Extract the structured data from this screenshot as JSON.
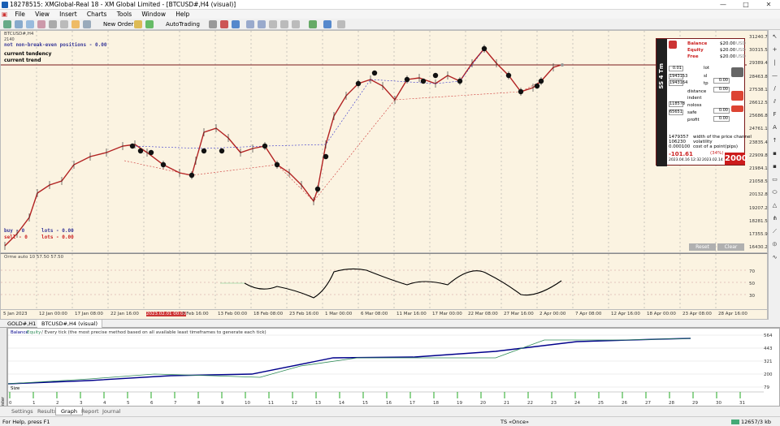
{
  "window": {
    "title": "18278515: XMGlobal-Real 18 - XM Global Limited - [BTCUSD#,H4 (visual)]",
    "min": "—",
    "max": "□",
    "close": "✕"
  },
  "menu": [
    "File",
    "View",
    "Insert",
    "Charts",
    "Tools",
    "Window",
    "Help"
  ],
  "toolbar": {
    "new_order": "New Order",
    "autotrading": "AutoTrading"
  },
  "chart": {
    "symbol_label": "BTCUSD#,H4",
    "sub_label": "2140",
    "info1": "not non-break-even positions - 0.00",
    "info2": "current tendency",
    "info3": "current trend",
    "buy": "buy - 0",
    "sell": "sell - 0",
    "lots_buy": "lots - 0.00",
    "lots_sell": "lots - 0.00",
    "price_axis": [
      "31240.75",
      "30315.50",
      "29389.45",
      "28463.80",
      "27538.15",
      "26612.50",
      "25686.80",
      "24761.15",
      "23835.45",
      "22909.80",
      "21984.15",
      "21058.50",
      "20132.85",
      "19207.20",
      "18281.55",
      "17355.90",
      "16430.25"
    ],
    "current_price": "29389.45",
    "reset_label": "Reset",
    "clear_label": "Clear"
  },
  "panel": {
    "side_label": "SS 4 Tm",
    "balance_label": "Balance",
    "balance_val": "$20.00",
    "equity_label": "Equity",
    "equity_val": "$20.00",
    "free_label": "Free",
    "free_val": "$20.00",
    "usd": "USD",
    "lot_label": "lot",
    "sl_label": "sl",
    "tp_label": "tp",
    "distance_label": "distance",
    "indent_label": "indent",
    "noloss_label": "noloss",
    "safe_label": "safe",
    "profit_label": "profit",
    "vals": [
      "0.00",
      "0.00",
      "0.00",
      "0.00"
    ],
    "small_vals": [
      "0.01",
      "1943153",
      "1943164",
      "118578",
      "65651"
    ],
    "stats": [
      "1479357",
      "106230",
      "0.000100"
    ],
    "stat_labels": [
      "width of the price channel",
      "volatility",
      "cost of a point(pips)"
    ],
    "loss": "-101.61",
    "pct": "(34%)",
    "big": "2000",
    "dates": [
      "2023.04.16 12:32",
      "2023.02.14"
    ]
  },
  "indicator": {
    "label": "Orme auto 10 57.50 57.50",
    "levels": [
      "70",
      "50",
      "30"
    ]
  },
  "xaxis": [
    "5 Jan 2023",
    "12 Jan 00:00",
    "17 Jan 08:00",
    "22 Jan 16:00",
    "2023.02.01 00:00",
    "7 Feb 16:00",
    "13 Feb 00:00",
    "18 Feb 08:00",
    "23 Feb 16:00",
    "1 Mar 00:00",
    "6 Mar 08:00",
    "11 Mar 16:00",
    "17 Mar 00:00",
    "22 Mar 08:00",
    "27 Mar 16:00",
    "2 Apr 00:00",
    "7 Apr 08:00",
    "12 Apr 16:00",
    "18 Apr 00:00",
    "23 Apr 08:00",
    "28 Apr 16:00"
  ],
  "chart_tabs": [
    "GOLD#,H1",
    "BTCUSD#,H4 (visual)"
  ],
  "tester": {
    "legend_balance": "Balance",
    "legend_equity": "Equity",
    "legend_text": "/ Every tick (the most precise method based on all available least timeframes to generate each tick)",
    "yaxis": [
      "564",
      "443",
      "321",
      "200",
      "79"
    ],
    "size_label": "Size",
    "xaxis": [
      "0",
      "1",
      "2",
      "3",
      "4",
      "5",
      "6",
      "7",
      "8",
      "9",
      "10",
      "11",
      "12",
      "13",
      "14",
      "15",
      "16",
      "17",
      "18",
      "19",
      "20",
      "21",
      "22",
      "23",
      "24",
      "25",
      "26",
      "27",
      "28",
      "29",
      "30",
      "31"
    ]
  },
  "bottom_tabs": [
    "Settings",
    "Results",
    "Graph",
    "Report",
    "Journal"
  ],
  "status": {
    "help": "For Help, press F1",
    "mode": "TS «Once»",
    "net": "12657/3 kb"
  },
  "colors": {
    "chart_bg": "#fbf3e1",
    "candle": "#b22222",
    "balance": "#00008b",
    "equity": "#2e8b57",
    "panel_red": "#cc2222"
  }
}
